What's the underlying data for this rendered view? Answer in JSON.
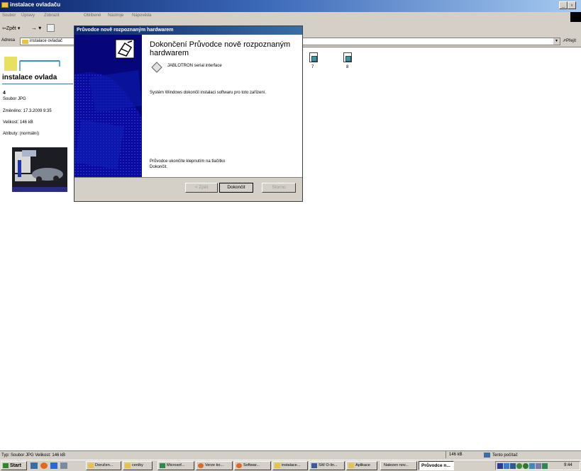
{
  "window": {
    "title": "instalace ovladaču"
  },
  "menu": [
    "Soubor",
    "Úpravy",
    "Zobrazit",
    "Oblíbené",
    "Nástroje",
    "Nápověda"
  ],
  "toolbar": {
    "back_label": "Zpět"
  },
  "address": {
    "label": "Adresa",
    "value": "instalace ovladač",
    "go_label": "Přejít"
  },
  "folder_pane": {
    "heading": "instalace ovlada",
    "item_name": "4",
    "item_type": "Soubor JPG",
    "modified": "Změněno: 17.3.2009 9:35",
    "size": "Velikost: 146 kB",
    "attributes": "Atributy: (normální)"
  },
  "files": [
    {
      "name": "7"
    },
    {
      "name": "8"
    }
  ],
  "dialog": {
    "title": "Průvodce nově rozpoznaným hardwarem",
    "heading": "Dokončení Průvodce nově rozpoznaným hardwarem",
    "device": "JABLOTRON serial interface",
    "message": "Systém Windows dokončil instalaci softwaru pro toto zařízení.",
    "footer": "Průvodce ukončíte klepnutím na tlačítko Dokončit.",
    "back_button": "< Zpět",
    "finish_button": "Dokončit",
    "cancel_button": "Storno"
  },
  "statusbar": {
    "left": "Typ: Soubor JPG Velikost: 146 kB",
    "size": "146 kB",
    "zone": "Tento počítač"
  },
  "taskbar": {
    "start": "Start",
    "tasks": [
      "Doručen...",
      "ceníky",
      "Microsof...",
      "Verze ko...",
      "Softwar...",
      "instalace...",
      "SW O-lin...",
      "Aplikace",
      "Nalezen nov...",
      "Průvodce n..."
    ],
    "clock": "9:44"
  }
}
